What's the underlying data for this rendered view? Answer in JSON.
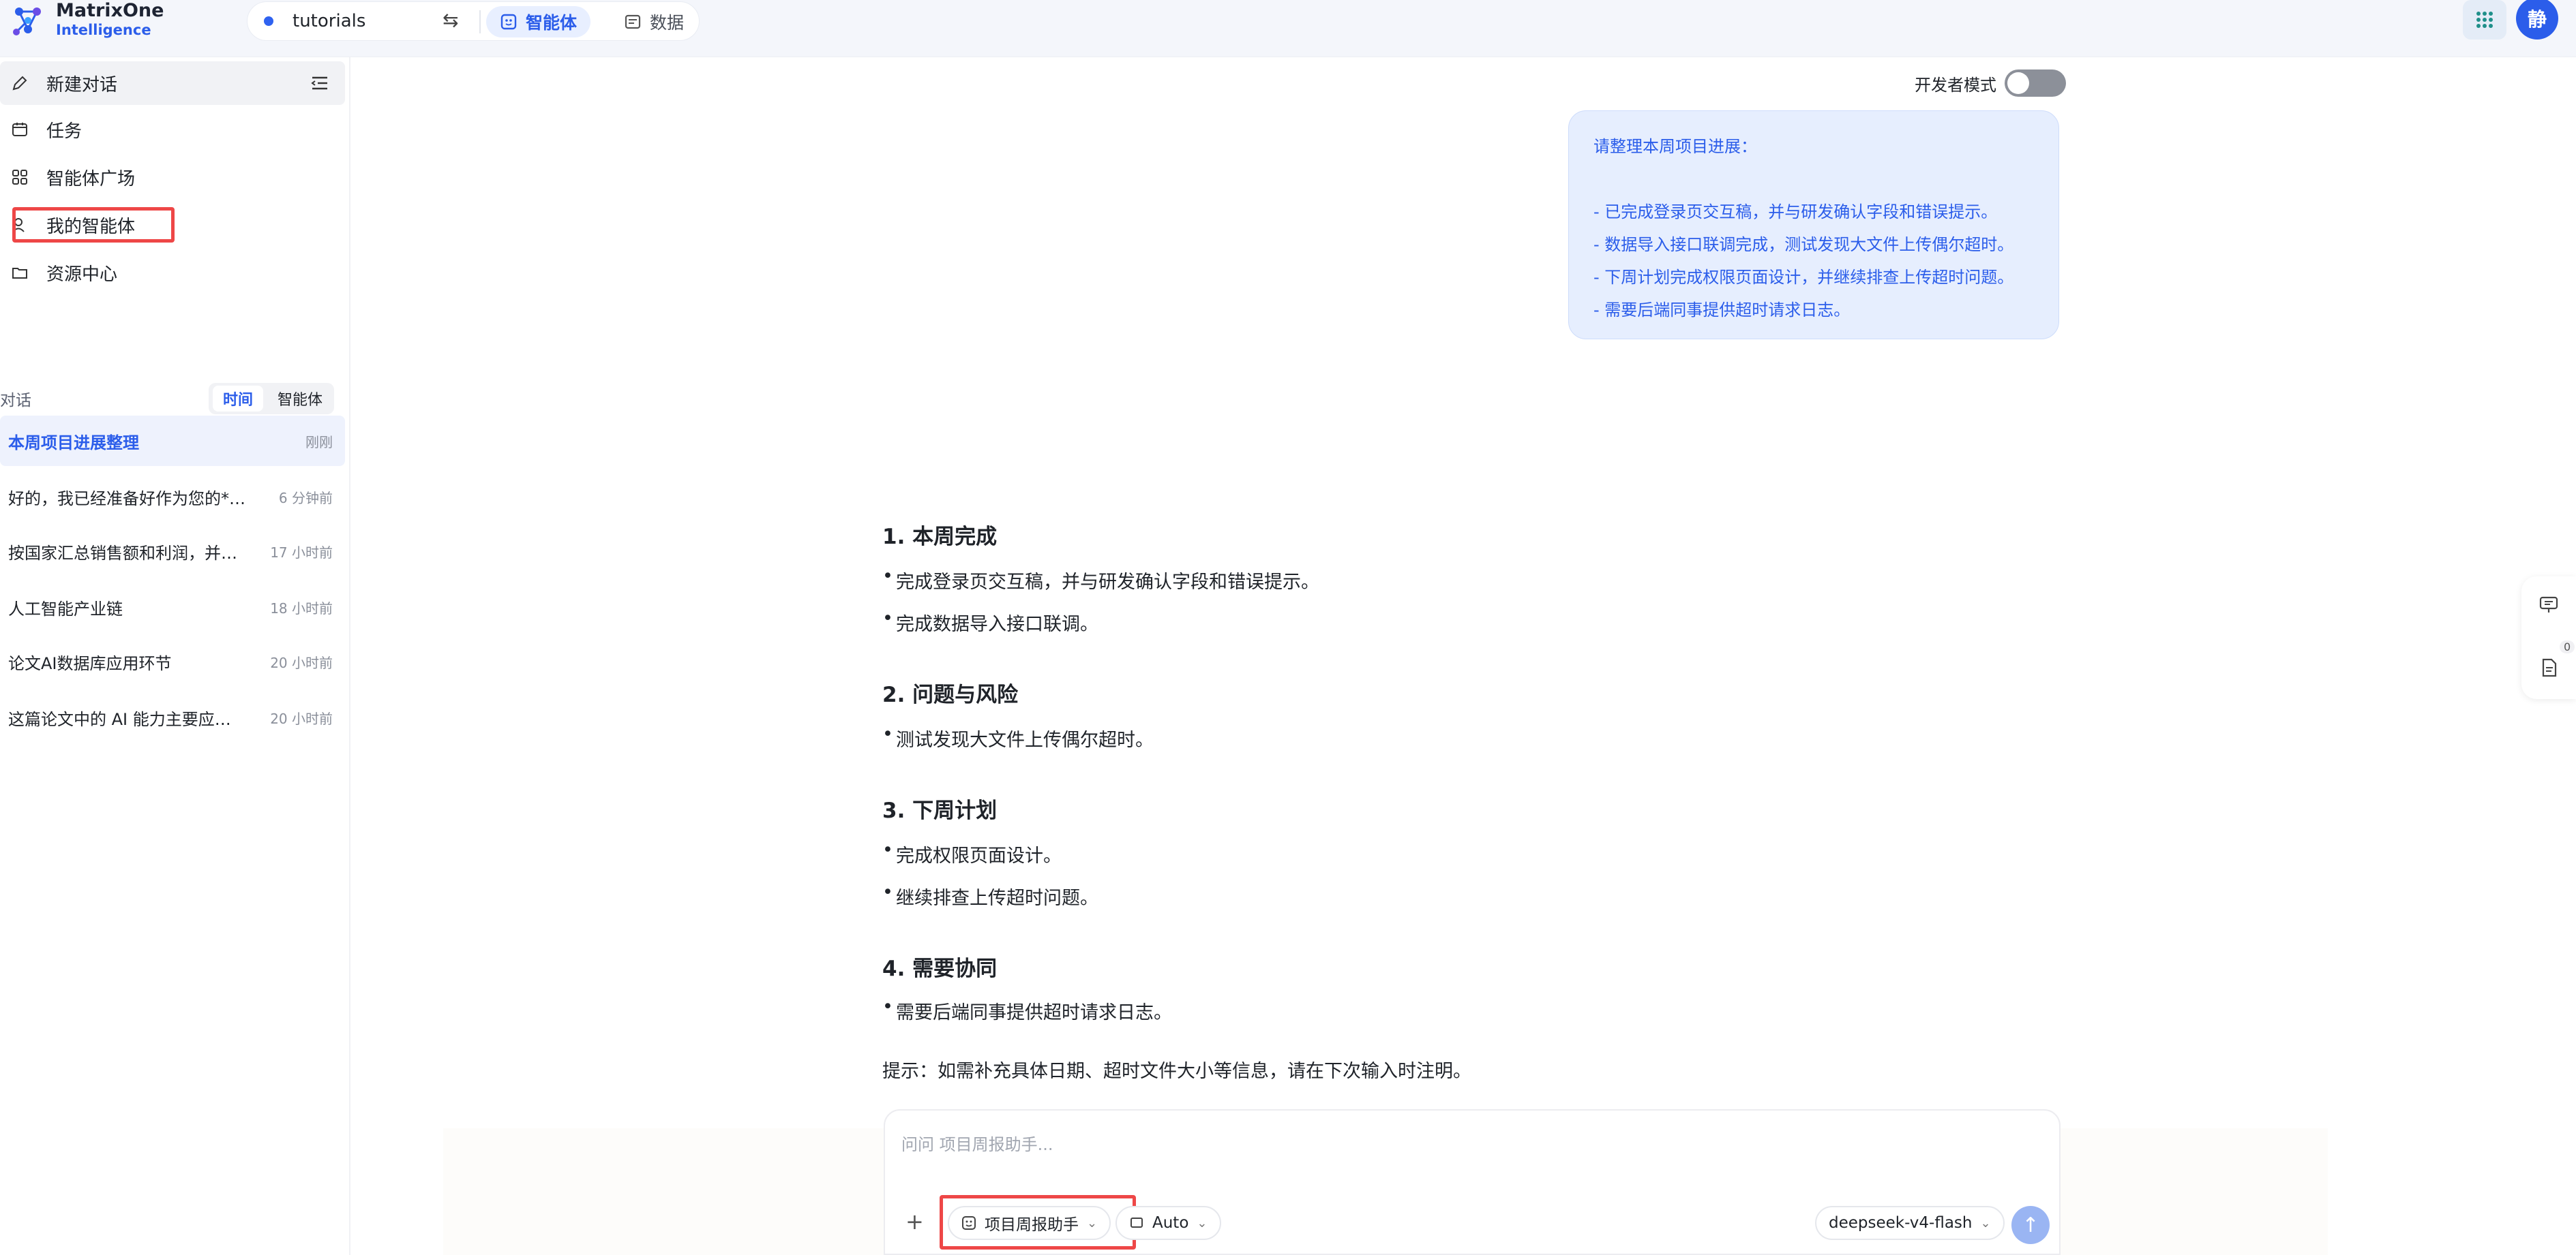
{
  "app": {
    "logo_line1": "MatrixOne",
    "logo_line2": "Intelligence",
    "project": "tutorials",
    "swap_icon": "⇆",
    "tabs": [
      {
        "label": "智能体",
        "active": true
      },
      {
        "label": "数据",
        "active": false
      }
    ],
    "avatar": "静",
    "accent": "#2b5dea"
  },
  "sidebar": {
    "items": [
      {
        "label": "新建对话",
        "icon": "edit-icon"
      },
      {
        "label": "任务",
        "icon": "calendar-icon"
      },
      {
        "label": "智能体广场",
        "icon": "grid-icon"
      },
      {
        "label": "我的智能体",
        "icon": "user-icon",
        "highlighted": true
      },
      {
        "label": "资源中心",
        "icon": "folder-icon"
      }
    ],
    "conv_header": "对话",
    "segments": [
      "时间",
      "智能体"
    ],
    "conversations": [
      {
        "title": "本周项目进展整理",
        "time": "刚刚",
        "active": true
      },
      {
        "title": "好的，我已经准备好作为您的**数据分析助手",
        "time": "6 分钟前"
      },
      {
        "title": "按国家汇总销售额和利润，并生成图表",
        "time": "17 小时前"
      },
      {
        "title": "人工智能产业链",
        "time": "18 小时前"
      },
      {
        "title": "论文AI数据库应用环节",
        "time": "20 小时前"
      },
      {
        "title": "这篇论文中的 AI 能力主要应用在哪些环节",
        "time": "20 小时前"
      }
    ]
  },
  "main": {
    "devmode_label": "开发者模式",
    "devmode_on": false,
    "user_message": [
      "请整理本周项目进展：",
      "",
      "- 已完成登录页交互稿，并与研发确认字段和错误提示。",
      "- 数据导入接口联调完成，测试发现大文件上传偶尔超时。",
      "- 下周计划完成权限页面设计，并继续排查上传超时问题。",
      "- 需要后端同事提供超时请求日志。"
    ],
    "answer": {
      "sections": [
        {
          "heading": "1. 本周完成",
          "items": [
            "完成登录页交互稿，并与研发确认字段和错误提示。",
            "完成数据导入接口联调。"
          ]
        },
        {
          "heading": "2. 问题与风险",
          "items": [
            "测试发现大文件上传偶尔超时。"
          ]
        },
        {
          "heading": "3. 下周计划",
          "items": [
            "完成权限页面设计。",
            "继续排查上传超时问题。"
          ]
        },
        {
          "heading": "4. 需要协同",
          "items": [
            "需要后端同事提供超时请求日志。"
          ]
        }
      ],
      "tip": "提示：如需补充具体日期、超时文件大小等信息，请在下次输入时注明。"
    },
    "input": {
      "placeholder": "问问 项目周报助手...",
      "plus": "+",
      "agent_chip": "项目周报助手",
      "mode_chip": "Auto",
      "model_chip": "deepseek-v4-flash",
      "chevron": "⌄",
      "send": "↑"
    },
    "dock_badge": "0"
  }
}
